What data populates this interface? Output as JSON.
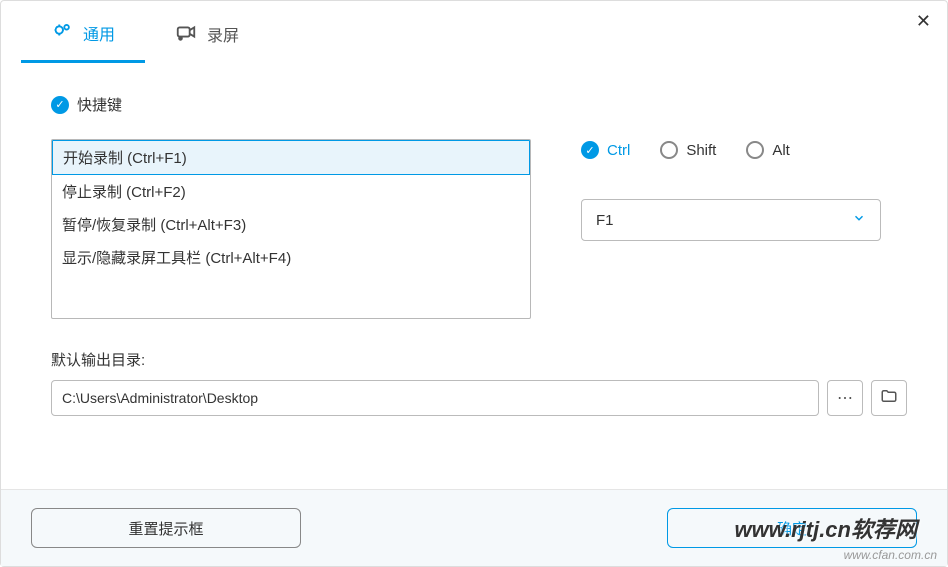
{
  "tabs": {
    "general": "通用",
    "screen_recording": "录屏"
  },
  "shortcuts": {
    "section_title": "快捷键",
    "items": [
      "开始录制 (Ctrl+F1)",
      "停止录制 (Ctrl+F2)",
      "暂停/恢复录制 (Ctrl+Alt+F3)",
      "显示/隐藏录屏工具栏 (Ctrl+Alt+F4)"
    ]
  },
  "modifiers": {
    "ctrl": "Ctrl",
    "shift": "Shift",
    "alt": "Alt"
  },
  "key_select": {
    "value": "F1"
  },
  "output": {
    "label": "默认输出目录:",
    "path": "C:\\Users\\Administrator\\Desktop"
  },
  "buttons": {
    "reset": "重置提示框",
    "ok": "确定"
  },
  "watermark": {
    "main": "www.rjtj.cn软荐网",
    "sub": "www.cfan.com.cn"
  }
}
